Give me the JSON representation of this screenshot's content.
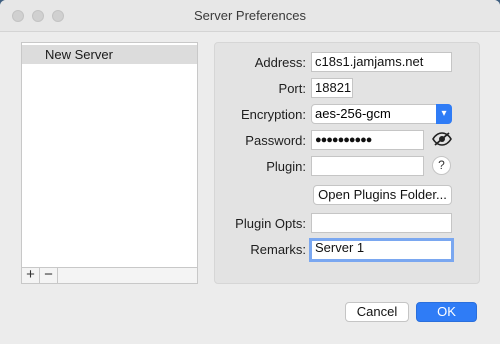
{
  "window": {
    "title": "Server Preferences"
  },
  "servers": {
    "items": [
      "New Server"
    ],
    "add_label": "+",
    "remove_label": "−"
  },
  "form": {
    "address_label": "Address:",
    "address_value": "c18s1.jamjams.net",
    "port_label": "Port:",
    "port_value": "18821",
    "encryption_label": "Encryption:",
    "encryption_value": "aes-256-gcm",
    "password_label": "Password:",
    "password_value": "●●●●●●●●●●",
    "plugin_label": "Plugin:",
    "plugin_value": "",
    "help_label": "?",
    "open_plugins_label": "Open Plugins Folder...",
    "plugin_opts_label": "Plugin Opts:",
    "plugin_opts_value": "",
    "remarks_label": "Remarks:",
    "remarks_value": "Server 1"
  },
  "footer": {
    "cancel_label": "Cancel",
    "ok_label": "OK"
  },
  "colors": {
    "accent": "#2f7cf6",
    "focus_ring": "#7aa7f0"
  },
  "icons": [
    "eye-slash-icon",
    "chevron-down-icon",
    "help-icon"
  ]
}
